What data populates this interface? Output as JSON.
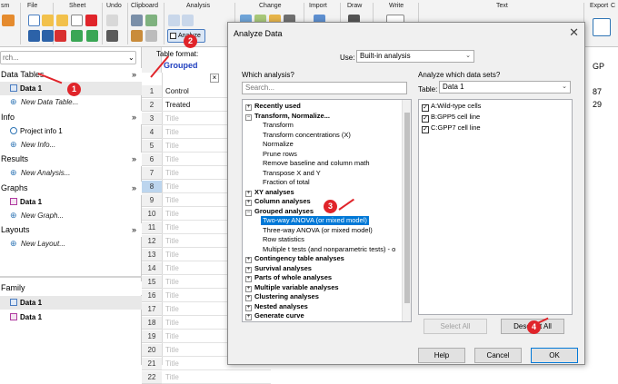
{
  "ribbon": {
    "groups": [
      "sm",
      "File",
      "Sheet",
      "Undo",
      "Clipboard",
      "Analysis",
      "Change",
      "Import",
      "Draw",
      "Write",
      "Text",
      "Export"
    ],
    "analyze_label": "Analyze",
    "table_format_label": "Table format:",
    "table_format_value": "Grouped",
    "right_col_label": "GP",
    "right_top_char": "C",
    "right_values": [
      "87",
      "29"
    ]
  },
  "navigator": {
    "search_placeholder": "rch...",
    "sections": [
      {
        "label": "Data Tables",
        "items": [
          {
            "label": "Data 1",
            "selected": true
          },
          {
            "label": "New Data Table...",
            "new": true
          }
        ]
      },
      {
        "label": "Info",
        "items": [
          {
            "label": "Project info 1"
          },
          {
            "label": "New Info...",
            "new": true
          }
        ]
      },
      {
        "label": "Results",
        "items": [
          {
            "label": "New Analysis...",
            "new": true
          }
        ]
      },
      {
        "label": "Graphs",
        "items": [
          {
            "label": "Data 1"
          },
          {
            "label": "New Graph...",
            "new": true
          }
        ]
      },
      {
        "label": "Layouts",
        "items": [
          {
            "label": "New Layout...",
            "new": true
          }
        ]
      }
    ],
    "family": {
      "label": "Family",
      "items": [
        "Data 1",
        "Data 1"
      ]
    }
  },
  "sheet": {
    "rows": [
      "Control",
      "Treated",
      "Title",
      "Title",
      "Title",
      "Title",
      "Title",
      "Title",
      "Title",
      "Title",
      "Title",
      "Title",
      "Title",
      "Title",
      "Title",
      "Title",
      "Title",
      "Title",
      "Title",
      "Title",
      "Title",
      "Title"
    ],
    "highlight_row": 8
  },
  "dialog": {
    "title": "Analyze Data",
    "use_label": "Use:",
    "use_value": "Built-in analysis",
    "which_analysis_label": "Which analysis?",
    "search_placeholder": "Search...",
    "tree": [
      {
        "label": "Recently used",
        "type": "cat",
        "sign": "+"
      },
      {
        "label": "Transform, Normalize...",
        "type": "cat",
        "sign": "-"
      },
      {
        "label": "Transform",
        "type": "sub"
      },
      {
        "label": "Transform concentrations (X)",
        "type": "sub"
      },
      {
        "label": "Normalize",
        "type": "sub"
      },
      {
        "label": "Prune rows",
        "type": "sub"
      },
      {
        "label": "Remove baseline and column math",
        "type": "sub"
      },
      {
        "label": "Transpose X and Y",
        "type": "sub"
      },
      {
        "label": "Fraction of total",
        "type": "sub"
      },
      {
        "label": "XY analyses",
        "type": "cat",
        "sign": "+"
      },
      {
        "label": "Column analyses",
        "type": "cat",
        "sign": "+"
      },
      {
        "label": "Grouped analyses",
        "type": "cat",
        "sign": "-"
      },
      {
        "label": "Two-way ANOVA (or mixed model)",
        "type": "sel"
      },
      {
        "label": "Three-way ANOVA (or mixed model)",
        "type": "sub"
      },
      {
        "label": "Row statistics",
        "type": "sub"
      },
      {
        "label": "Multiple t tests (and nonparametric tests) - o",
        "type": "sub"
      },
      {
        "label": "Contingency table analyses",
        "type": "cat",
        "sign": "+"
      },
      {
        "label": "Survival analyses",
        "type": "cat",
        "sign": "+"
      },
      {
        "label": "Parts of whole analyses",
        "type": "cat",
        "sign": "+"
      },
      {
        "label": "Multiple variable analyses",
        "type": "cat",
        "sign": "+"
      },
      {
        "label": "Clustering analyses",
        "type": "cat",
        "sign": "+"
      },
      {
        "label": "Nested analyses",
        "type": "cat",
        "sign": "+"
      },
      {
        "label": "Generate curve",
        "type": "cat",
        "sign": "+"
      }
    ],
    "datasets_label": "Analyze which data sets?",
    "table_label": "Table:",
    "table_value": "Data 1",
    "datasets": [
      "A:Wild-type cells",
      "B:GPP5 cell line",
      "C:GPP7 cell line"
    ],
    "select_all": "Select All",
    "deselect_all": "Deselect All",
    "help": "Help",
    "cancel": "Cancel",
    "ok": "OK"
  },
  "annotations": [
    "1",
    "2",
    "3",
    "4"
  ],
  "colors": {
    "accent": "#0078d7",
    "annotation": "#e0242a",
    "grouped": "#1f3fbf"
  }
}
